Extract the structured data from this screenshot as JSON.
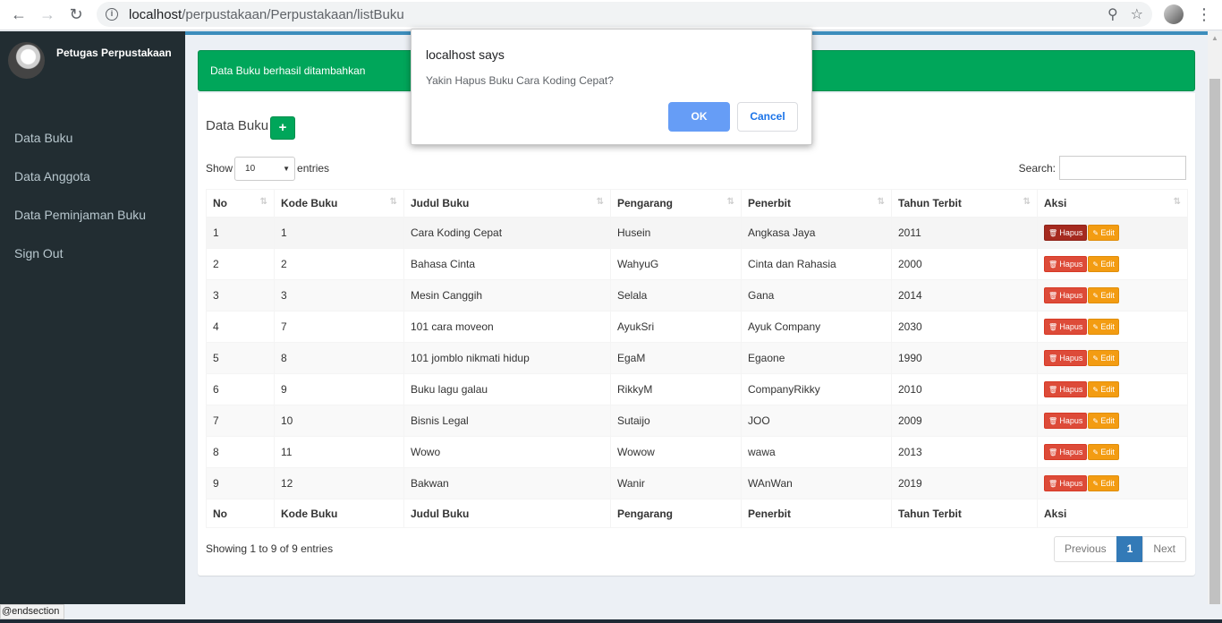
{
  "browser": {
    "url_host": "localhost",
    "url_path": "/perpustakaan/Perpustakaan/listBuku",
    "back_icon": "arrow-left-icon",
    "forward_icon": "arrow-right-icon",
    "reload_icon": "reload-icon",
    "zoom_icon": "zoom-icon",
    "star_icon": "star-icon"
  },
  "sidebar": {
    "user_name": "Petugas Perpustakaan",
    "items": [
      {
        "label": "Data Buku"
      },
      {
        "label": "Data Anggota"
      },
      {
        "label": "Data Peminjaman Buku"
      },
      {
        "label": "Sign Out"
      }
    ]
  },
  "alert": {
    "text": "Data Buku berhasil ditambahkan",
    "color": "#00a65a"
  },
  "box": {
    "title": "Data Buku",
    "add_label": "+"
  },
  "datatable": {
    "show_label": "Show",
    "length_value": "10",
    "entries_label": "entries",
    "search_label": "Search:",
    "columns": [
      "No",
      "Kode Buku",
      "Judul Buku",
      "Pengarang",
      "Penerbit",
      "Tahun Terbit",
      "Aksi"
    ],
    "rows": [
      [
        "1",
        "1",
        "Cara Koding Cepat",
        "Husein",
        "Angkasa Jaya",
        "2011"
      ],
      [
        "2",
        "2",
        "Bahasa Cinta",
        "WahyuG",
        "Cinta dan Rahasia",
        "2000"
      ],
      [
        "3",
        "3",
        "Mesin Canggih",
        "Selala",
        "Gana",
        "2014"
      ],
      [
        "4",
        "7",
        "101 cara moveon",
        "AyukSri",
        "Ayuk Company",
        "2030"
      ],
      [
        "5",
        "8",
        "101 jomblo nikmati hidup",
        "EgaM",
        "Egaone",
        "1990"
      ],
      [
        "6",
        "9",
        "Buku lagu galau",
        "RikkyM",
        "CompanyRikky",
        "2010"
      ],
      [
        "7",
        "10",
        "Bisnis Legal",
        "Sutaijo",
        "JOO",
        "2009"
      ],
      [
        "8",
        "11",
        "Wowo",
        "Wowow",
        "wawa",
        "2013"
      ],
      [
        "9",
        "12",
        "Bakwan",
        "Wanir",
        "WAnWan",
        "2019"
      ]
    ],
    "hapus_label": "Hapus",
    "edit_label": "Edit",
    "info": "Showing 1 to 9 of 9 entries",
    "pagination": {
      "previous": "Previous",
      "page": "1",
      "next": "Next"
    }
  },
  "status_bar": "@endsection",
  "dialog": {
    "title": "localhost says",
    "message": "Yakin Hapus Buku Cara Koding Cepat?",
    "ok": "OK",
    "cancel": "Cancel"
  }
}
